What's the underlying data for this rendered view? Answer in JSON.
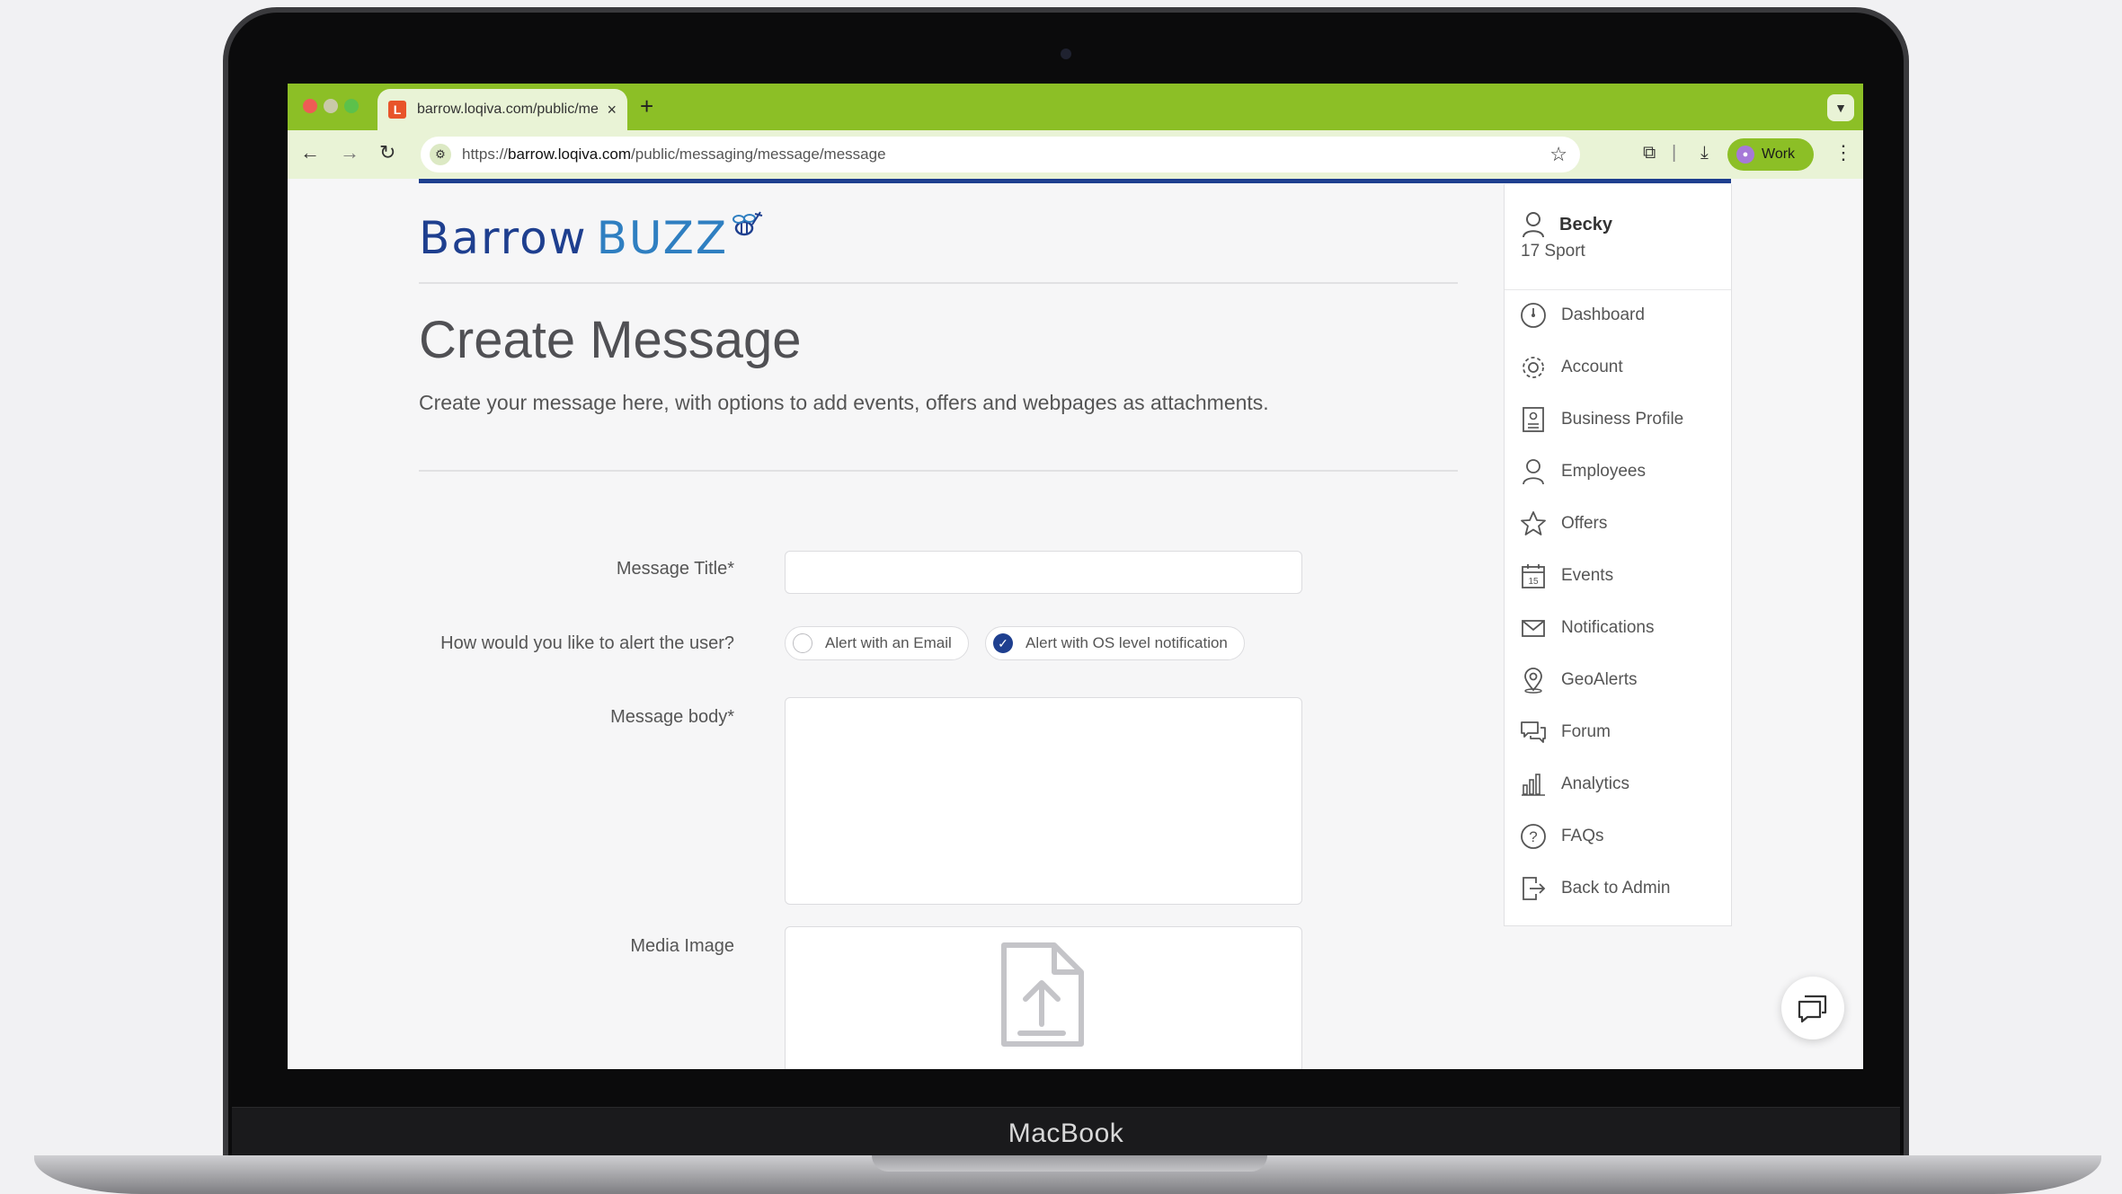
{
  "device": {
    "brand": "MacBook"
  },
  "browser": {
    "tab_title": "barrow.loqiva.com/public/me",
    "tab_favicon": "L",
    "tab_close": "×",
    "new_tab": "+",
    "url_prefix": "https://",
    "url_domain": "barrow.loqiva.com",
    "url_path": "/public/messaging/message/message",
    "profile_label": "Work",
    "accent_color": "#8cbf26"
  },
  "logo": {
    "part1": "Barrow",
    "part2": "BUZZ"
  },
  "page": {
    "title": "Create Message",
    "subtitle": "Create your message here, with options to add events, offers and webpages as attachments."
  },
  "form": {
    "title_label": "Message Title*",
    "title_value": "",
    "alert_label": "How would you like to alert the user?",
    "alert_email": "Alert with an Email",
    "alert_os": "Alert with OS level notification",
    "alert_email_checked": false,
    "alert_os_checked": true,
    "body_label": "Message body*",
    "body_value": "",
    "media_label": "Media Image"
  },
  "sidebar": {
    "user_name": "Becky",
    "user_org": "17 Sport",
    "items": [
      {
        "label": "Dashboard",
        "icon": "dashboard-icon"
      },
      {
        "label": "Account",
        "icon": "gear-icon"
      },
      {
        "label": "Business Profile",
        "icon": "profile-card-icon"
      },
      {
        "label": "Employees",
        "icon": "person-icon"
      },
      {
        "label": "Offers",
        "icon": "star-icon"
      },
      {
        "label": "Events",
        "icon": "calendar-icon"
      },
      {
        "label": "Notifications",
        "icon": "envelope-icon"
      },
      {
        "label": "GeoAlerts",
        "icon": "map-pin-icon"
      },
      {
        "label": "Forum",
        "icon": "chat-bubbles-icon"
      },
      {
        "label": "Analytics",
        "icon": "bar-chart-icon"
      },
      {
        "label": "FAQs",
        "icon": "question-icon"
      },
      {
        "label": "Back to Admin",
        "icon": "exit-icon"
      }
    ]
  },
  "brand_colors": {
    "primary": "#1e3f8f",
    "secondary": "#2f7fc1"
  }
}
